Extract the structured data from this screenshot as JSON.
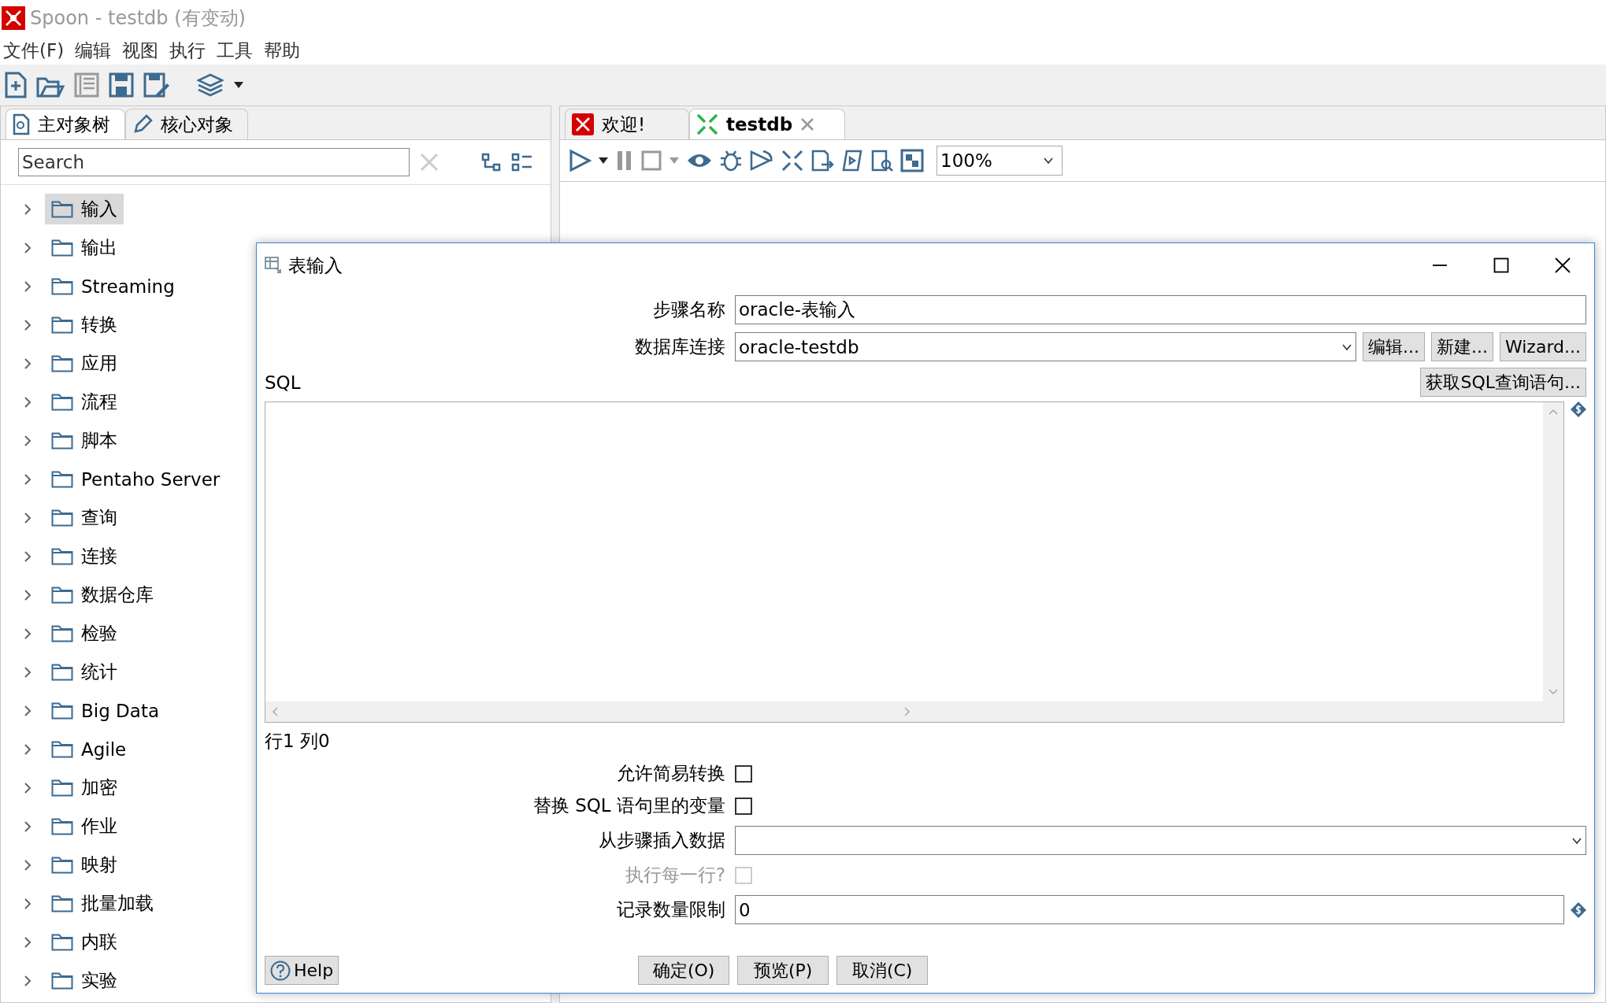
{
  "window": {
    "title": "Spoon - testdb (有变动)"
  },
  "menu": [
    "文件(F)",
    "编辑",
    "视图",
    "执行",
    "工具",
    "帮助"
  ],
  "left_tabs": [
    {
      "label": "主对象树",
      "selected": true
    },
    {
      "label": "核心对象",
      "selected": false
    }
  ],
  "search": {
    "placeholder": "Search"
  },
  "tree": [
    {
      "label": "输入",
      "selected": true,
      "expanded": false
    },
    {
      "label": "输出",
      "selected": false,
      "expanded": false
    },
    {
      "label": "Streaming",
      "selected": false,
      "expanded": false
    },
    {
      "label": "转换",
      "selected": false,
      "expanded": false
    },
    {
      "label": "应用",
      "selected": false,
      "expanded": false
    },
    {
      "label": "流程",
      "selected": false,
      "expanded": false
    },
    {
      "label": "脚本",
      "selected": false,
      "expanded": false
    },
    {
      "label": "Pentaho Server",
      "selected": false,
      "expanded": false
    },
    {
      "label": "查询",
      "selected": false,
      "expanded": false
    },
    {
      "label": "连接",
      "selected": false,
      "expanded": false
    },
    {
      "label": "数据仓库",
      "selected": false,
      "expanded": false
    },
    {
      "label": "检验",
      "selected": false,
      "expanded": false
    },
    {
      "label": "统计",
      "selected": false,
      "expanded": false
    },
    {
      "label": "Big Data",
      "selected": false,
      "expanded": false
    },
    {
      "label": "Agile",
      "selected": false,
      "expanded": false
    },
    {
      "label": "加密",
      "selected": false,
      "expanded": false
    },
    {
      "label": "作业",
      "selected": false,
      "expanded": false
    },
    {
      "label": "映射",
      "selected": false,
      "expanded": false
    },
    {
      "label": "批量加载",
      "selected": false,
      "expanded": false
    },
    {
      "label": "内联",
      "selected": false,
      "expanded": false
    },
    {
      "label": "实验",
      "selected": false,
      "expanded": false
    }
  ],
  "editor_tabs": [
    {
      "label": "欢迎!",
      "selected": false,
      "closable": false
    },
    {
      "label": "testdb",
      "selected": true,
      "closable": true
    }
  ],
  "zoom": "100%",
  "dialog": {
    "title": "表输入",
    "step_name": {
      "label": "步骤名称",
      "value": "oracle-表输入"
    },
    "connection": {
      "label": "数据库连接",
      "value": "oracle-testdb",
      "buttons": [
        "编辑...",
        "新建...",
        "Wizard..."
      ]
    },
    "sql_label": "SQL",
    "sql_button": "获取SQL查询语句...",
    "cursor_position": "行1 列0",
    "options": [
      {
        "kind": "checkbox",
        "label": "允许简易转换",
        "checked": false,
        "disabled": false
      },
      {
        "kind": "checkbox",
        "label": "替换 SQL 语句里的变量",
        "checked": false,
        "disabled": false
      },
      {
        "kind": "select",
        "label": "从步骤插入数据"
      },
      {
        "kind": "checkbox",
        "label": "执行每一行?",
        "checked": false,
        "disabled": true
      },
      {
        "kind": "input",
        "label": "记录数量限制",
        "value": "0"
      }
    ],
    "help": "Help",
    "buttons": [
      "确定(O)",
      "预览(P)",
      "取消(C)"
    ]
  }
}
